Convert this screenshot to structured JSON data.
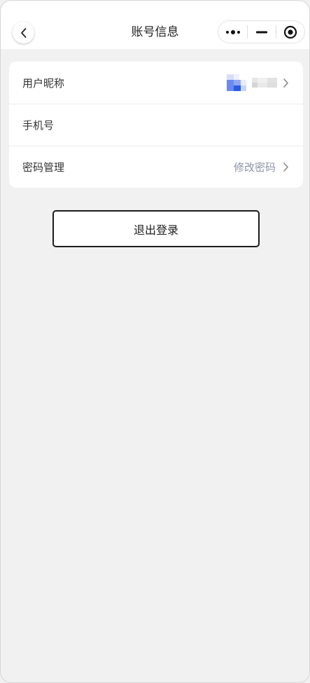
{
  "nav": {
    "title": "账号信息"
  },
  "icons": {
    "back": "chevron-left-icon",
    "more": "more-dots-icon",
    "minimize": "minimize-icon",
    "close": "target-close-icon",
    "row_arrow": "chevron-right-icon"
  },
  "rows": [
    {
      "label": "用户昵称",
      "value": ""
    },
    {
      "label": "手机号",
      "value": ""
    },
    {
      "label": "密码管理",
      "value": "修改密码"
    }
  ],
  "logout": {
    "label": "退出登录"
  },
  "colors": {
    "background": "#f1f1f1",
    "card": "#ffffff",
    "value_text": "#8c94a6",
    "avatar_accent": "#2b5ae6"
  }
}
